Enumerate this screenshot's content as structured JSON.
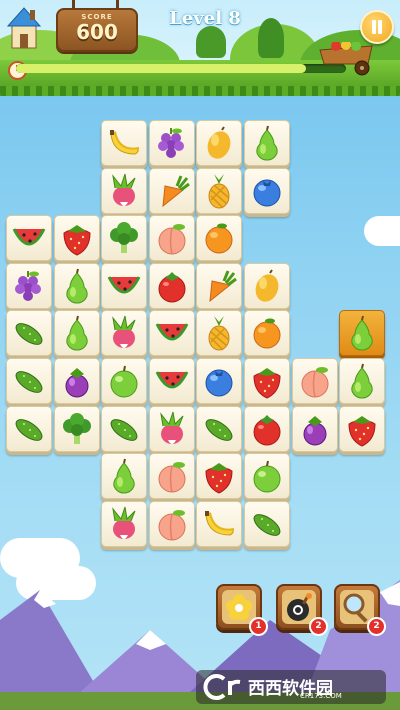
{
  "header": {
    "score_label": "SCORE",
    "score": "600",
    "level": "Level 8",
    "time_progress": 0.88
  },
  "board": {
    "rows": [
      [
        null,
        null,
        "banana",
        "grape",
        "mango",
        "pear",
        null,
        null
      ],
      [
        null,
        null,
        "radish",
        "carrot",
        "pineapple",
        "blueberry",
        null,
        null
      ],
      [
        "watermelon",
        "strawberry",
        "broccoli",
        "peach",
        "orange",
        null,
        null,
        null
      ],
      [
        "grape",
        "pear",
        "watermelon",
        "tomato",
        "carrot",
        "mango",
        null,
        null
      ],
      [
        "cucumber",
        "pear",
        "radish",
        "watermelon",
        "pineapple",
        "orange",
        null,
        "pear"
      ],
      [
        "cucumber",
        "eggplant",
        "apple",
        "watermelon",
        "blueberry",
        "strawberry",
        "peach",
        "pear"
      ],
      [
        "cucumber",
        "broccoli",
        "cucumber",
        "radish",
        "cucumber",
        "tomato",
        "eggplant",
        "strawberry"
      ],
      [
        null,
        null,
        "pear",
        "peach",
        "strawberry",
        "apple",
        null,
        null
      ],
      [
        null,
        null,
        "radish",
        "peach",
        "banana",
        "cucumber",
        null,
        null
      ]
    ],
    "selected": [
      [
        4,
        7
      ]
    ]
  },
  "powerups": [
    {
      "icon": "flower-icon",
      "count": "1"
    },
    {
      "icon": "bomb-icon",
      "count": "2"
    },
    {
      "icon": "magnifier-icon",
      "count": "2"
    }
  ],
  "watermark": {
    "title": "西西软件园",
    "url": "CR173.COM"
  }
}
